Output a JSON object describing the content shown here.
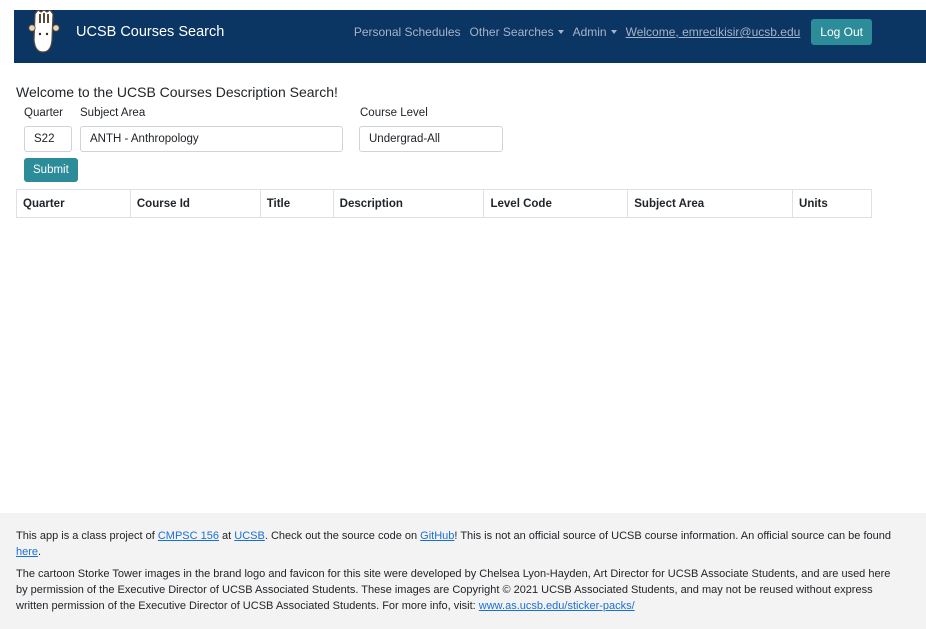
{
  "navbar": {
    "brand_title": "UCSB Courses Search",
    "links": {
      "personal_schedules": "Personal Schedules",
      "other_searches": "Other Searches",
      "admin": "Admin",
      "welcome": "Welcome, emrecikisir@ucsb.edu"
    },
    "logout_label": "Log Out",
    "icons": {
      "brand_logo": "storke-tower-cartoon-icon"
    },
    "colors": {
      "background": "#0b3563",
      "accent_button": "#2d8c99"
    }
  },
  "main": {
    "title": "Welcome to the UCSB Courses Description Search!",
    "form": {
      "quarter": {
        "label": "Quarter",
        "value": "S22"
      },
      "subject_area": {
        "label": "Subject Area",
        "value": "ANTH - Anthropology"
      },
      "course_level": {
        "label": "Course Level",
        "value": "Undergrad-All"
      },
      "submit_label": "Submit"
    },
    "table": {
      "columns": [
        "Quarter",
        "Course Id",
        "Title",
        "Description",
        "Level Code",
        "Subject Area",
        "Units"
      ],
      "rows": []
    }
  },
  "footer": {
    "p1": {
      "t1": "This app is a class project of ",
      "link_cmpsc": "CMPSC 156",
      "t2": " at ",
      "link_ucsb": "UCSB",
      "t3": ". Check out the source code on ",
      "link_github": "GitHub",
      "t4": "! This is not an official source of UCSB course information. An official source can be found ",
      "link_here": "here",
      "t5": "."
    },
    "p2": {
      "text": "The cartoon Storke Tower images in the brand logo and favicon for this site were developed by Chelsea Lyon-Hayden, Art Director for UCSB Associate Students, and are used here by permission of the Executive Director of UCSB Associated Students. These images are Copyright © 2021 UCSB Associated Students, and may not be reused without express written permission of the Executive Director of UCSB Associated Students. For more info, visit: ",
      "link_sticker": "www.as.ucsb.edu/sticker-packs/"
    }
  }
}
